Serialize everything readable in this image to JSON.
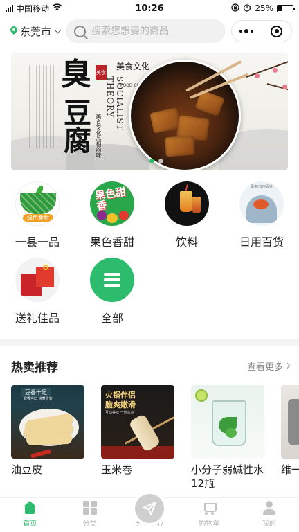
{
  "status_bar": {
    "carrier": "中国移动",
    "time": "10:26",
    "battery": "25%",
    "battery_level": 0.25
  },
  "header": {
    "location": "东莞市",
    "search_placeholder": "搜索您想要的商品"
  },
  "banner": {
    "title_main": "臭",
    "title_sub": "豆腐",
    "seal": "美食",
    "slogan": "美食文化品相韵味",
    "english_vertical": "SOCIALIST THEORY",
    "cn_tag": "美食文化",
    "en_tag": "FOOD CULTURE",
    "slide_count": 2,
    "active_slide": 0
  },
  "categories": [
    {
      "label": "一县一品",
      "icon": "county-product-icon",
      "icon_text": "绿色食材"
    },
    {
      "label": "果色香甜",
      "icon": "fruit-icon",
      "icon_text": "果色甜香"
    },
    {
      "label": "饮料",
      "icon": "drink-icon"
    },
    {
      "label": "日用百货",
      "icon": "daily-goods-icon",
      "icon_text": "薯条/日用百货"
    },
    {
      "label": "送礼佳品",
      "icon": "gift-icon"
    },
    {
      "label": "全部",
      "icon": "all-menu-icon"
    }
  ],
  "hot": {
    "title": "热卖推荐",
    "more": "查看更多",
    "products": [
      {
        "name": "油豆皮",
        "img_caption": "豆香十足",
        "img_caption_sub": "鲜香可口 炖煮皆宜"
      },
      {
        "name": "玉米卷",
        "img_caption": "火锅伴侣",
        "img_caption_2": "脆爽嫩滑",
        "img_caption_sub": "互动美味 一份心意"
      },
      {
        "name": "小分子弱碱性水12瓶"
      },
      {
        "name": "维一不沾"
      }
    ]
  },
  "tab_bar": {
    "tabs": [
      {
        "label": "首页",
        "icon": "home-icon",
        "active": true
      },
      {
        "label": "分类",
        "icon": "category-grid-icon",
        "active": false
      },
      {
        "label": "分享中心",
        "icon": "share-plane-icon",
        "active": false
      },
      {
        "label": "购物车",
        "icon": "cart-icon",
        "active": false
      },
      {
        "label": "我的",
        "icon": "user-icon",
        "active": false
      }
    ]
  },
  "colors": {
    "accent": "#2dbb6d",
    "tab_inactive": "#b5b5b5",
    "section_bg": "#f5f5f5"
  }
}
